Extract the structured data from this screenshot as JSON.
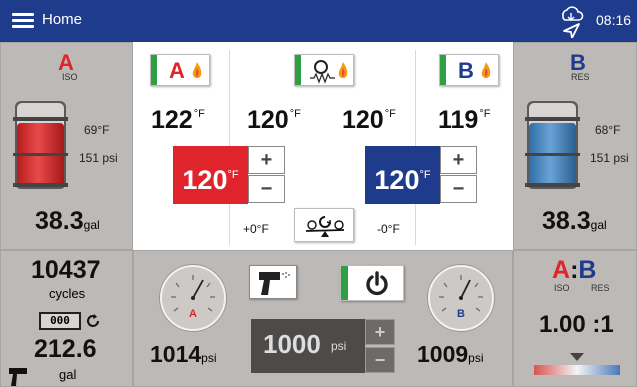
{
  "header": {
    "title": "Home",
    "time": "08:16",
    "menu_icon": "menu-icon",
    "status_icon": "cloud-location-icon"
  },
  "colors": {
    "a_red": "#e0242c",
    "b_blue": "#1f3c8c",
    "header_bg": "#1f3c8c",
    "badge_green": "#2ea043"
  },
  "side_a": {
    "letter": "A",
    "sub": "ISO",
    "temp": "69°F",
    "pressure": "151 psi",
    "volume": "38.3",
    "volume_unit": "gal"
  },
  "side_b": {
    "letter": "B",
    "sub": "RES",
    "temp": "68°F",
    "pressure": "151 psi",
    "volume": "38.3",
    "volume_unit": "gal"
  },
  "heaters": {
    "a": {
      "badge": "A",
      "actual": "122",
      "unit": "°F",
      "setpoint": "120"
    },
    "hose": {
      "actual_left": "120",
      "actual_right": "120",
      "unit": "°F"
    },
    "b": {
      "badge": "B",
      "actual": "119",
      "unit": "°F",
      "setpoint": "120"
    },
    "plus": "+",
    "minus": "−",
    "offset_left": "+0°F",
    "offset_right": "-0°F"
  },
  "cycles": {
    "count": "10437",
    "label": "cycles",
    "counter_text": "000",
    "volume": "212.6",
    "volume_unit": "gal"
  },
  "pressure": {
    "a_gauge_label": "A",
    "b_gauge_label": "B",
    "a_value": "1014",
    "b_value": "1009",
    "unit": "psi",
    "setpoint": "1000",
    "setpoint_unit": "psi",
    "plus": "+",
    "minus": "−"
  },
  "ratio": {
    "a": "A",
    "colon": ":",
    "b": "B",
    "a_sub": "ISO",
    "b_sub": "RES",
    "value": "1.00 :1"
  }
}
